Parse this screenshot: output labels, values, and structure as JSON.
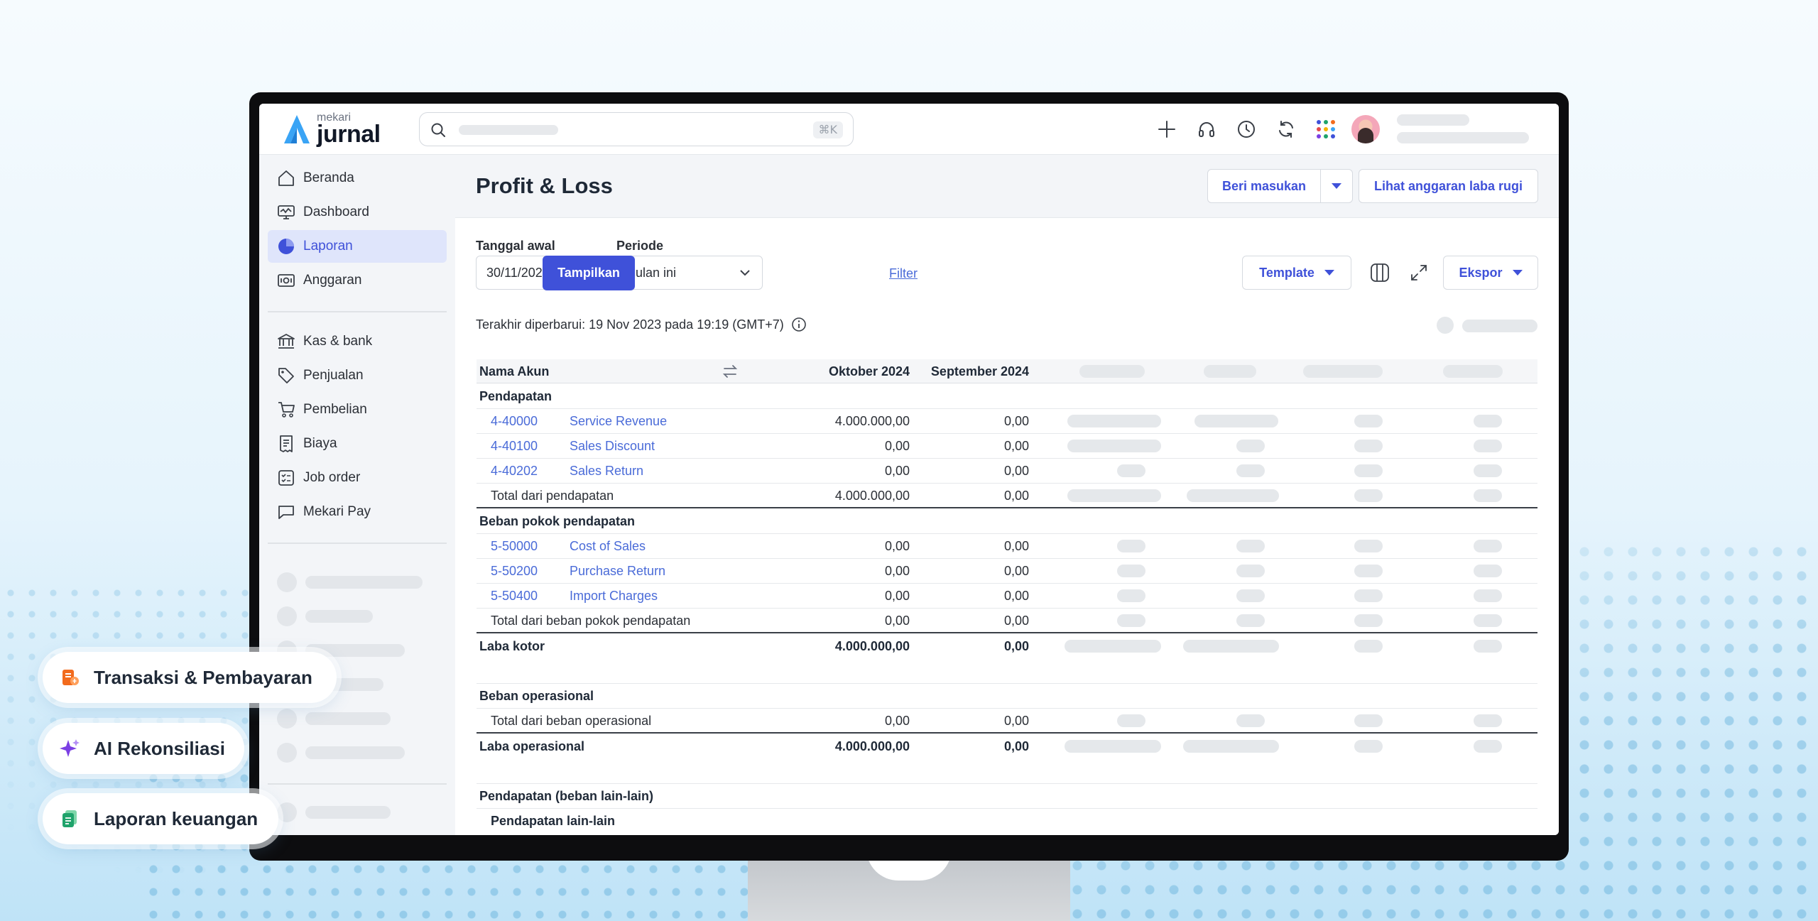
{
  "app": {
    "logo_small": "mekari",
    "logo_big": "jurnal",
    "search_shortcut": "⌘K"
  },
  "sidebar": {
    "items": [
      {
        "label": "Beranda",
        "icon": "home-icon"
      },
      {
        "label": "Dashboard",
        "icon": "monitor-icon"
      },
      {
        "label": "Laporan",
        "icon": "pie-chart-icon",
        "active": true
      },
      {
        "label": "Anggaran",
        "icon": "budget-icon"
      },
      {
        "label": "Kas & bank",
        "icon": "bank-icon"
      },
      {
        "label": "Penjualan",
        "icon": "tag-icon"
      },
      {
        "label": "Pembelian",
        "icon": "cart-icon"
      },
      {
        "label": "Biaya",
        "icon": "receipt-icon"
      },
      {
        "label": "Job order",
        "icon": "checklist-icon"
      },
      {
        "label": "Mekari Pay",
        "icon": "chat-icon"
      }
    ]
  },
  "header": {
    "title": "Profit & Loss",
    "feedback_button": "Beri masukan",
    "budget_button": "Lihat anggaran laba rugi"
  },
  "filters": {
    "start_date_label": "Tanggal awal",
    "start_date_value": "30/11/2021",
    "period_label": "Periode",
    "period_value": "Bulan ini",
    "show_button": "Tampilkan",
    "filter_link": "Filter",
    "template_button": "Template",
    "export_button": "Ekspor"
  },
  "last_updated": "Terakhir diperbarui: 19 Nov 2023 pada 19:19 (GMT+7)",
  "table": {
    "columns": [
      "Nama Akun",
      "Oktober 2024",
      "September 2024"
    ],
    "rows": [
      {
        "type": "section",
        "label": "Pendapatan"
      },
      {
        "type": "account",
        "code": "4-40000",
        "name": "Service Revenue",
        "oct": "4.000.000,00",
        "sep": "0,00"
      },
      {
        "type": "account",
        "code": "4-40100",
        "name": "Sales Discount",
        "oct": "0,00",
        "sep": "0,00"
      },
      {
        "type": "account",
        "code": "4-40202",
        "name": "Sales Return",
        "oct": "0,00",
        "sep": "0,00"
      },
      {
        "type": "total",
        "label": "Total dari pendapatan",
        "oct": "4.000.000,00",
        "sep": "0,00"
      },
      {
        "type": "section",
        "label": "Beban pokok pendapatan"
      },
      {
        "type": "account",
        "code": "5-50000",
        "name": "Cost of Sales",
        "oct": "0,00",
        "sep": "0,00"
      },
      {
        "type": "account",
        "code": "5-50200",
        "name": "Purchase Return",
        "oct": "0,00",
        "sep": "0,00"
      },
      {
        "type": "account",
        "code": "5-50400",
        "name": "Import Charges",
        "oct": "0,00",
        "sep": "0,00"
      },
      {
        "type": "total",
        "label": "Total dari beban pokok pendapatan",
        "oct": "0,00",
        "sep": "0,00"
      },
      {
        "type": "bold",
        "label": "Laba kotor",
        "oct": "4.000.000,00",
        "sep": "0,00"
      },
      {
        "type": "section",
        "label": "Beban operasional"
      },
      {
        "type": "total",
        "label": "Total dari beban operasional",
        "oct": "0,00",
        "sep": "0,00"
      },
      {
        "type": "bold",
        "label": "Laba operasional",
        "oct": "4.000.000,00",
        "sep": "0,00"
      },
      {
        "type": "section",
        "label": "Pendapatan (beban lain-lain)"
      },
      {
        "type": "subsection",
        "label": "Pendapatan lain-lain"
      }
    ]
  },
  "chips": [
    {
      "label": "Transaksi & Pembayaran",
      "icon": "transaction-icon",
      "color": "#f26b1d"
    },
    {
      "label": "AI Rekonsiliasi",
      "icon": "sparkle-icon",
      "color": "#7b3fe4"
    },
    {
      "label": "Laporan keuangan",
      "icon": "report-stack-icon",
      "color": "#1fa36b"
    }
  ],
  "colors": {
    "primary": "#3f51d9",
    "link": "#4a6bd8",
    "active_nav_bg": "#dfe5fb"
  }
}
